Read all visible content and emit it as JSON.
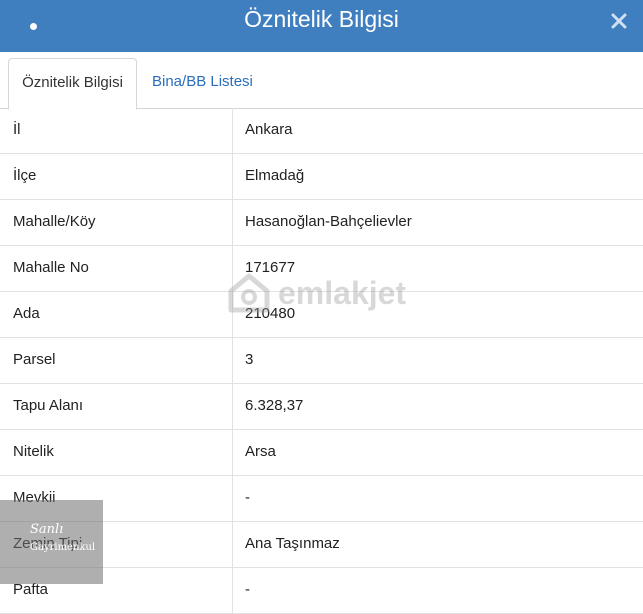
{
  "dialog": {
    "title": "Öznitelik Bilgisi",
    "colors": {
      "titlebar_bg": "#3f7fbf",
      "link": "#2a6ebb"
    }
  },
  "tabs": [
    {
      "label": "Öznitelik Bilgisi",
      "active": true
    },
    {
      "label": "Bina/BB Listesi",
      "active": false
    }
  ],
  "rows": [
    {
      "key": "İl",
      "value": "Ankara"
    },
    {
      "key": "İlçe",
      "value": "Elmadağ"
    },
    {
      "key": "Mahalle/Köy",
      "value": "Hasanoğlan-Bahçelievler"
    },
    {
      "key": "Mahalle No",
      "value": "171677"
    },
    {
      "key": "Ada",
      "value": "210480"
    },
    {
      "key": "Parsel",
      "value": "3"
    },
    {
      "key": "Tapu Alanı",
      "value": "6.328,37"
    },
    {
      "key": "Nitelik",
      "value": "Arsa"
    },
    {
      "key": "Mevkii",
      "value": "-"
    },
    {
      "key": "Zemin Tipi",
      "value": "Ana Taşınmaz"
    },
    {
      "key": "Pafta",
      "value": "-"
    }
  ],
  "watermark": {
    "text": "emlakjet"
  },
  "stamp": {
    "line1": "Sanlı",
    "line2": "Gayrimenkul"
  }
}
